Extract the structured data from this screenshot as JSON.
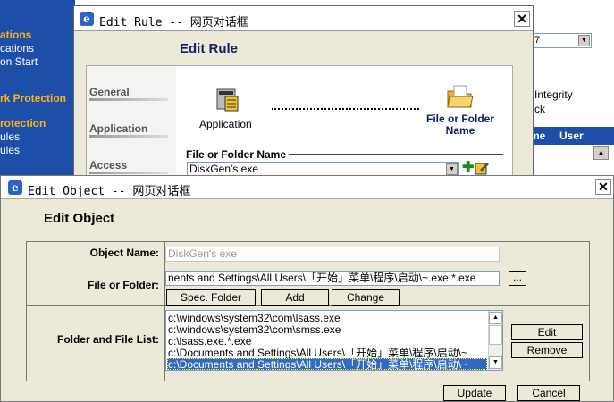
{
  "background_app": {
    "left_nav": [
      "ations",
      "cations",
      "on Start",
      "rk Protection",
      "rotection",
      "ules",
      "ules"
    ],
    "select_value": "7",
    "integrity_label": "Integrity",
    "ck_label": "ck",
    "grid_headers": [
      "me",
      "User"
    ]
  },
  "rule_dialog": {
    "title": "Edit Rule -- 网页对话框",
    "heading": "Edit Rule",
    "tabs": [
      "General",
      "Application",
      "Access"
    ],
    "application_label": "Application",
    "folder_label": "File or Folder Name",
    "section_label": "File or Folder Name",
    "selected_value": "DiskGen's exe"
  },
  "object_dialog": {
    "title": "Edit Object -- 网页对话框",
    "heading": "Edit Object",
    "object_name_label": "Object Name:",
    "object_name_value": "DiskGen's exe",
    "file_or_folder_label": "File or Folder:",
    "file_or_folder_value": "nents and Settings\\All Users\\「开始」菜单\\程序\\启动\\~.exe.*.exe",
    "browse_label": "...",
    "spec_folder_label": "Spec. Folder",
    "add_label": "Add",
    "change_label": "Change",
    "list_label": "Folder and File List:",
    "list_items": [
      "c:\\windows\\system32\\com\\lsass.exe",
      "c:\\windows\\system32\\com\\smss.exe",
      "c:\\lsass.exe.*.exe",
      "c:\\Documents and Settings\\All Users\\「开始」菜单\\程序\\启动\\~",
      "c:\\Documents and Settings\\All Users\\「开始」菜单\\程序\\启动\\~"
    ],
    "selected_index": 4,
    "edit_label": "Edit",
    "remove_label": "Remove",
    "update_label": "Update",
    "cancel_label": "Cancel"
  },
  "colors": {
    "nav_blue": "#1d4fa8",
    "nav_highlight": "#ffb01e",
    "heading_navy": "#0f1f66",
    "selection": "#316ac5"
  }
}
